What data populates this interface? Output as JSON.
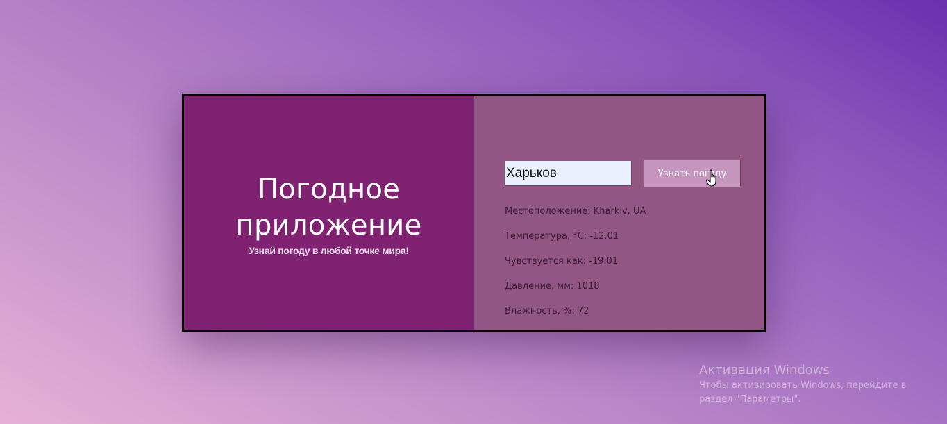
{
  "app": {
    "title": "Погодное приложение",
    "subtitle": "Узнай погоду в любой точке мира!"
  },
  "search": {
    "value": "Харьков",
    "button_label": "Узнать погоду"
  },
  "weather": {
    "location": "Местоположение: Kharkiv, UA",
    "temperature": "Температура, °C: -12.01",
    "feels_like": "Чувствуется как: -19.01",
    "pressure": "Давление, мм: 1018",
    "humidity": "Влажность, %: 72"
  },
  "watermark": {
    "title": "Активация Windows",
    "text": "Чтобы активировать Windows, перейдите в раздел \"Параметры\"."
  },
  "colors": {
    "left_panel": "#7e2271",
    "right_panel": "#915684",
    "button": "#c696c0",
    "input": "#e8f0fe"
  },
  "icons": {
    "cursor": "hand-pointer-icon"
  }
}
